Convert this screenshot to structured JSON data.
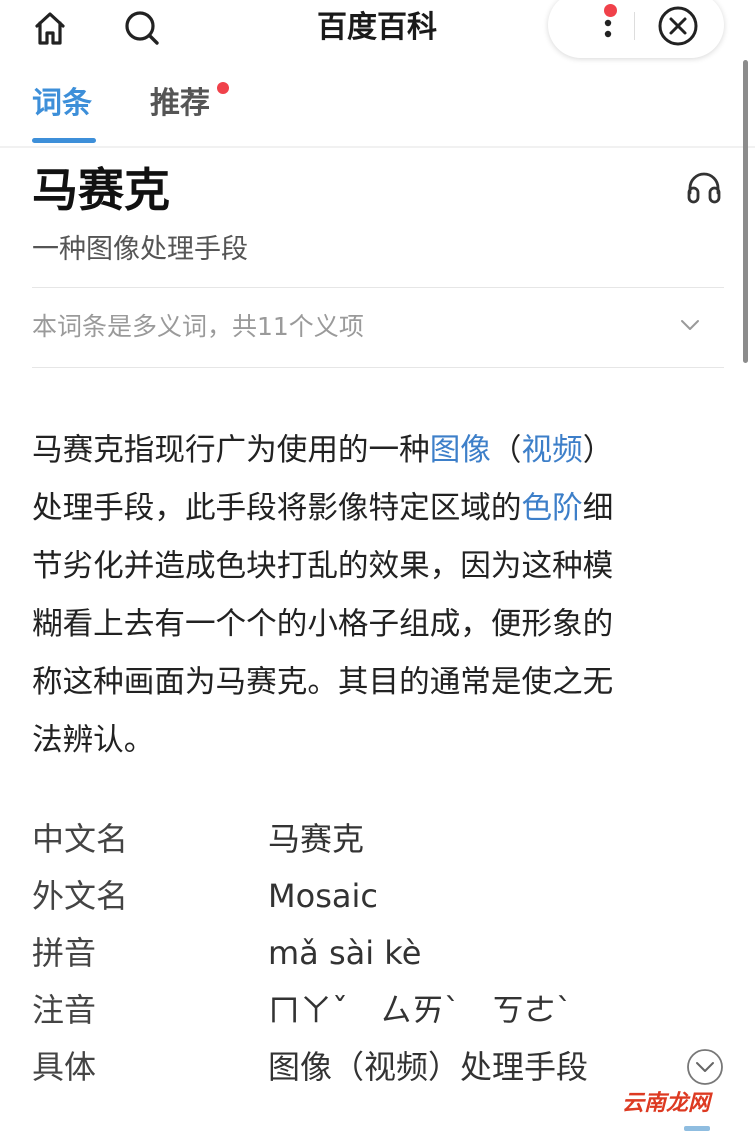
{
  "app": {
    "title": "百度百科"
  },
  "colors": {
    "accent": "#3d8fd9",
    "link": "#3d7fc9",
    "badge": "#f0414a",
    "watermark": "#dd3a22"
  },
  "topbar": {
    "icons": [
      "home-icon",
      "search-icon",
      "more-vertical-icon",
      "close-circle-icon"
    ],
    "has_notification_dot": true
  },
  "tabs": [
    {
      "label": "词条",
      "selected": true,
      "has_badge": false
    },
    {
      "label": "推荐",
      "selected": false,
      "has_badge": true
    }
  ],
  "entry": {
    "title": "马赛克",
    "subtitle": "一种图像处理手段",
    "listen_icon": "headphones-icon",
    "polysemy_text": "本词条是多义词，共11个义项",
    "polysemy_icon": "chevron-down-icon"
  },
  "summary_lines": [
    [
      {
        "text": "马赛克指现行广为使用的一种",
        "link": false
      },
      {
        "text": "图像",
        "link": true
      },
      {
        "text": "（",
        "link": false
      },
      {
        "text": "视频",
        "link": true
      },
      {
        "text": "）",
        "link": false
      }
    ],
    [
      {
        "text": "处理手段，此手段将影像特定区域的",
        "link": false
      },
      {
        "text": "色阶",
        "link": true
      },
      {
        "text": "细",
        "link": false
      }
    ],
    [
      {
        "text": "节劣化并造成色块打乱的效果，因为这种模",
        "link": false
      }
    ],
    [
      {
        "text": "糊看上去有一个个的小格子组成，便形象的",
        "link": false
      }
    ],
    [
      {
        "text": "称这种画面为马赛克。其目的通常是使之无",
        "link": false
      }
    ],
    [
      {
        "text": "法辨认。",
        "link": false
      }
    ]
  ],
  "basic_info": [
    {
      "key": "中文名",
      "value": "马赛克"
    },
    {
      "key": "外文名",
      "value": "Mosaic"
    },
    {
      "key": "拼音",
      "value": "mǎ sài kè"
    },
    {
      "key": "注音",
      "value": "ㄇㄚˇ　ㄙㄞˋ　ㄎㄜˋ"
    },
    {
      "key": "具体",
      "value": "图像（视频）处理手段"
    }
  ],
  "expand_icon": "chevron-down-circle-icon",
  "watermark": "云南龙网"
}
